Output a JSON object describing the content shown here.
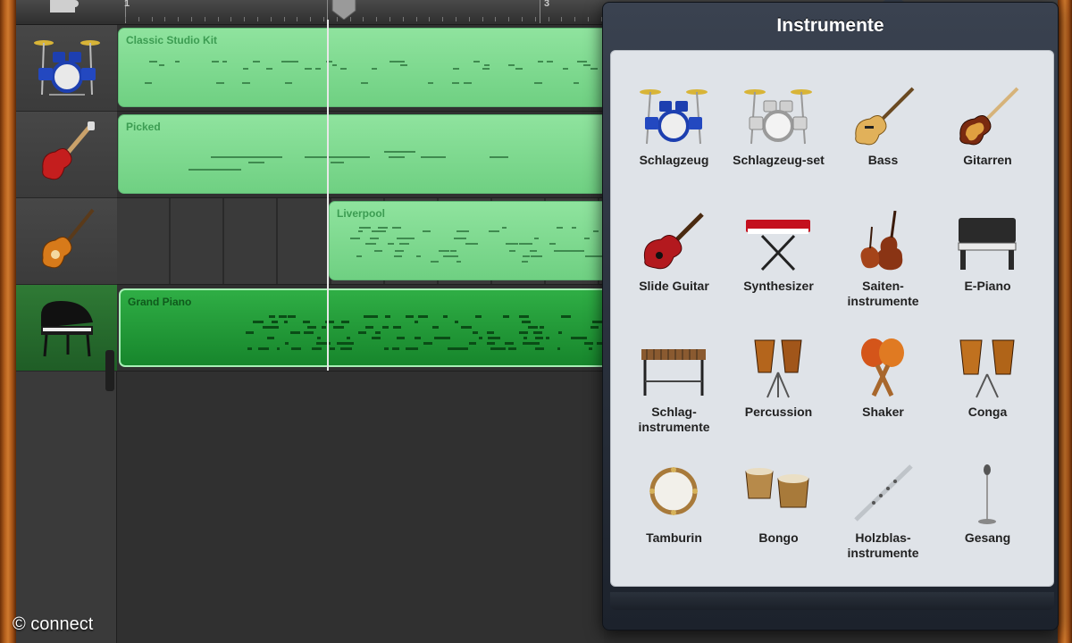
{
  "ruler": {
    "bars": [
      "1",
      "2",
      "3"
    ]
  },
  "tracks": [
    {
      "icon": "drum-kit-icon",
      "region": "Classic Studio Kit"
    },
    {
      "icon": "electric-guitar-icon",
      "region": "Picked"
    },
    {
      "icon": "bass-guitar-icon",
      "region": "Liverpool"
    },
    {
      "icon": "grand-piano-icon",
      "region": "Grand Piano"
    }
  ],
  "popover": {
    "title": "Instrumente",
    "items": [
      {
        "label": "Schlagzeug",
        "icon": "drums-icon"
      },
      {
        "label": "Schlagzeug-set",
        "icon": "drum-set-icon"
      },
      {
        "label": "Bass",
        "icon": "bass-icon"
      },
      {
        "label": "Gitarren",
        "icon": "guitar-icon"
      },
      {
        "label": "Slide Guitar",
        "icon": "slide-guitar-icon"
      },
      {
        "label": "Synthesizer",
        "icon": "synthesizer-icon"
      },
      {
        "label": "Saiten-\ninstrumente",
        "icon": "strings-icon"
      },
      {
        "label": "E-Piano",
        "icon": "e-piano-icon"
      },
      {
        "label": "Schlag-\ninstrumente",
        "icon": "xylophone-icon"
      },
      {
        "label": "Percussion",
        "icon": "percussion-icon"
      },
      {
        "label": "Shaker",
        "icon": "shaker-icon"
      },
      {
        "label": "Conga",
        "icon": "conga-icon"
      },
      {
        "label": "Tamburin",
        "icon": "tambourine-icon"
      },
      {
        "label": "Bongo",
        "icon": "bongo-icon"
      },
      {
        "label": "Holzblas-\ninstrumente",
        "icon": "flute-icon"
      },
      {
        "label": "Gesang",
        "icon": "microphone-icon"
      }
    ]
  },
  "credit": "© connect",
  "colors": {
    "region": "#7ed98f",
    "region_selected": "#22a23a",
    "popover": "#2a313b"
  }
}
